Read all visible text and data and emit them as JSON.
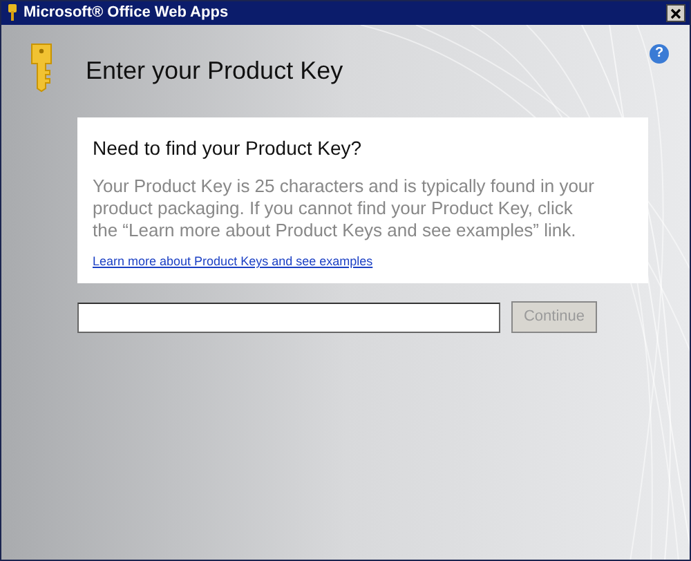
{
  "window": {
    "title": "Microsoft® Office Web Apps"
  },
  "heading": "Enter your Product Key",
  "info_card": {
    "title": "Need to find your Product Key?",
    "body": "Your Product Key is 25 characters and is typically found in your product packaging. If you cannot find your Product Key, click the “Learn more about Product Keys and see examples” link.",
    "link": "Learn more about Product Keys and see examples"
  },
  "help_button": {
    "label": "?"
  },
  "continue_button": {
    "label": "Continue",
    "disabled": true
  }
}
